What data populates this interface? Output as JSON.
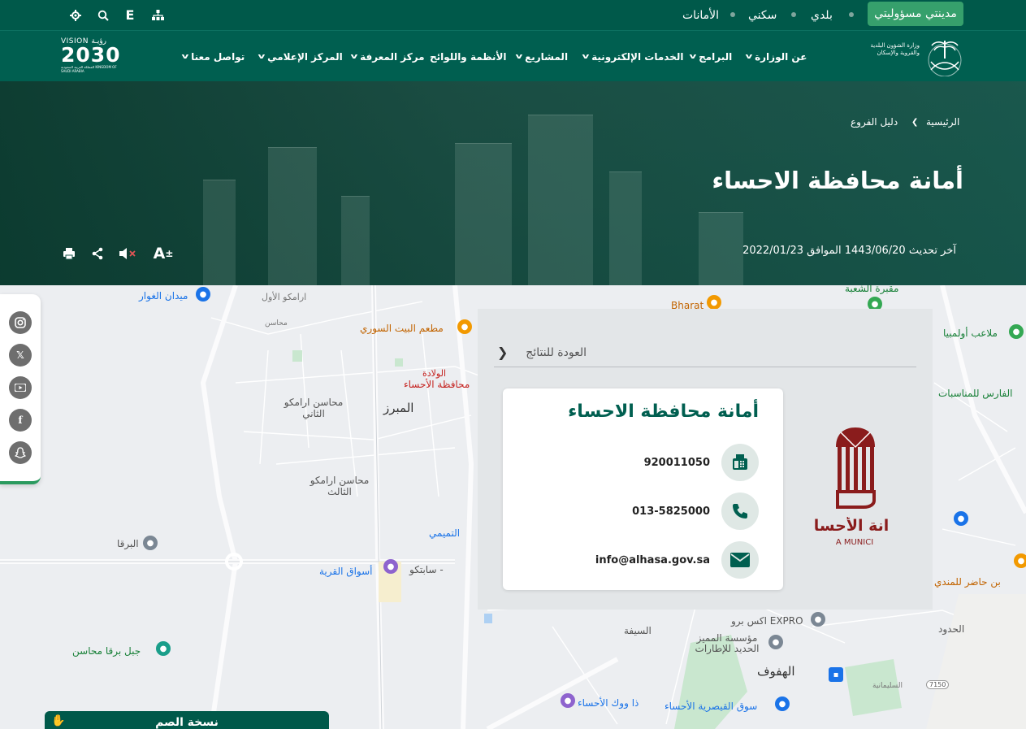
{
  "topbar": {
    "items": [
      "مدينتي مسؤوليتي",
      "بلدي",
      "سكني",
      "الأمانات"
    ],
    "lang_label": "E"
  },
  "nav": {
    "items": [
      {
        "label": "عن الوزارة",
        "has_dropdown": true
      },
      {
        "label": "البرامج",
        "has_dropdown": true
      },
      {
        "label": "الخدمات الإلكترونية",
        "has_dropdown": true
      },
      {
        "label": "المشاريع",
        "has_dropdown": true
      },
      {
        "label": "الأنظمة واللوائح",
        "has_dropdown": false
      },
      {
        "label": "مركز المعرفة",
        "has_dropdown": true
      },
      {
        "label": "المركز الإعلامي",
        "has_dropdown": true
      },
      {
        "label": "تواصل معنا",
        "has_dropdown": true
      }
    ],
    "ministry_logo_text": "وزارة الشؤون البلدية والقروية والإسكان",
    "vision": {
      "top": "VISION رؤيـة",
      "year": "2030",
      "sub": "المملكة العربية السعودية KINGDOM OF SAUDI ARABIA"
    }
  },
  "hero": {
    "breadcrumb": [
      "الرئيسية",
      "دليل الفروع"
    ],
    "title": "أمانة محافظة الاحساء",
    "updated": "آخر تحديث 1443/06/20 الموافق 2022/01/23"
  },
  "map_labels": {
    "midan": "ميدان الغوار",
    "aramco1": "ارامكو الأول",
    "mahasen": "محاسن",
    "restaurant": "مطعم البيت السوري",
    "bharat": "Bharat",
    "maqbara": "مقبرة الشعبة",
    "olympia": "ملاعب أولمبيا",
    "faris": "الفارس للمناسبات",
    "wiladah": "الولادة",
    "muhafaza": "محافظة الأحساء",
    "mubarraz": "المبرز",
    "aramco2": "محاسن ارامكو الثاني",
    "aramco3": "محاسن ارامكو الثالث",
    "tamimi": "التميمي",
    "barqa": "البرقا",
    "sabteco": "سابتكو -",
    "aswaq": "أسواق القرية",
    "jabal": "جبل برقا محاسن",
    "expro": "اكس برو EXPRO",
    "saifa": "السيفة",
    "muassasa": "مؤسسة المميز الحديد للإطارات",
    "hufuf": "الهفوف",
    "qaisariya": "سوق القيصرية الأحساء",
    "dawook": "ذا ووك الأحساء",
    "hudud": "الحدود",
    "mandi": "بن حاضر للمندي",
    "route": "7150",
    "sulaimaniya": "السليمانية"
  },
  "panel": {
    "back_label": "العودة للنتائج",
    "card_title": "أمانة محافظة الاحساء",
    "fax": "920011050",
    "phone": "013-5825000",
    "email": "info@alhasa.gov.sa",
    "logo_text": "انة الأحسا",
    "logo_sub": "A MUNICI"
  },
  "social": [
    "instagram",
    "x",
    "youtube",
    "facebook",
    "snapchat"
  ],
  "bottom_widget": {
    "label": "نسخة الصم"
  },
  "colors": {
    "primary": "#00594a",
    "accent": "#36a06c",
    "logo_red": "#8a1c1c"
  }
}
